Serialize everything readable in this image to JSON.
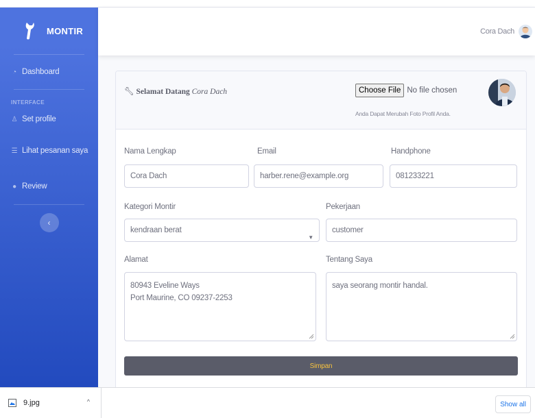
{
  "app": {
    "brand": "MONTIR"
  },
  "sidebar": {
    "heading": "INTERFACE",
    "items": [
      {
        "label": "Dashboard",
        "icon": "tachometer-icon"
      },
      {
        "label": "Set profile",
        "icon": "user-icon"
      },
      {
        "label": "Lihat pesanan saya",
        "icon": "list-icon"
      },
      {
        "label": "Review",
        "icon": "comments-icon"
      }
    ],
    "toggle_glyph": "‹"
  },
  "topbar": {
    "user_name": "Cora Dach"
  },
  "card": {
    "welcome_prefix": "Selamat Datang",
    "welcome_name": "Cora Dach",
    "file": {
      "button_label": "Choose File",
      "status": "No file chosen",
      "help": "Anda Dapat Merubah Foto Profil Anda."
    }
  },
  "form": {
    "nama": {
      "label": "Nama Lengkap",
      "value": "Cora Dach"
    },
    "email": {
      "label": "Email",
      "value": "harber.rene@example.org"
    },
    "handphone": {
      "label": "Handphone",
      "value": "081233221"
    },
    "kategori": {
      "label": "Kategori Montir",
      "value": "kendraan berat"
    },
    "pekerjaan": {
      "label": "Pekerjaan",
      "value": "customer"
    },
    "alamat": {
      "label": "Alamat",
      "line1": "80943 Eveline Ways",
      "line2": "Port Maurine, CO 09237-2253"
    },
    "tentang": {
      "label": "Tentang Saya",
      "value": "saya seorang montir handal."
    },
    "submit_label": "Simpan"
  },
  "downloads": {
    "file_name": "9.jpg",
    "caret": "^",
    "show_all": "Show all"
  },
  "colors": {
    "sidebar": "#4e73df",
    "sidebar_dark": "#224abe",
    "button": "#5a5c69",
    "button_text": "#f6c23e",
    "link": "#1a73e8"
  }
}
